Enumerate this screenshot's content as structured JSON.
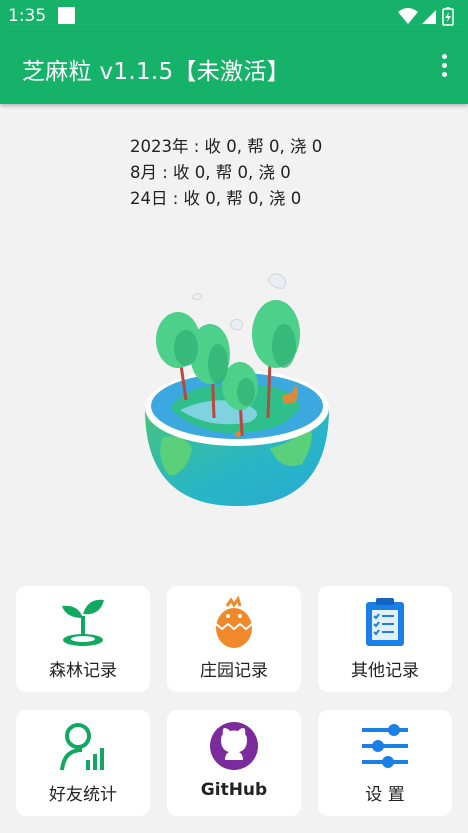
{
  "status_bar": {
    "time": "1:35"
  },
  "app_bar": {
    "title": "芝麻粒 v1.1.5【未激活】",
    "overflow_menu_icon": "more-vert-icon"
  },
  "stats": {
    "year_line": "2023年 : 收 0,  帮 0,  浇 0",
    "month_line": "8月 : 收 0,  帮 0,  浇 0",
    "day_line": "24日 : 收 0,  帮 0,  浇 0"
  },
  "illustration": {
    "icon": "forest-globe-illustration"
  },
  "menu": {
    "forest_records": {
      "label": "森林记录",
      "icon": "sprout-icon"
    },
    "farm_records": {
      "label": "庄园记录",
      "icon": "chick-egg-icon"
    },
    "other_records": {
      "label": "其他记录",
      "icon": "clipboard-checklist-icon"
    },
    "friend_stats": {
      "label": "好友统计",
      "icon": "user-stats-icon"
    },
    "github": {
      "label": "GitHub",
      "icon": "github-icon"
    },
    "settings": {
      "label": "设 置",
      "icon": "sliders-icon"
    }
  },
  "colors": {
    "primary": "#17b26a",
    "background": "#f2f2f2",
    "card": "#ffffff"
  }
}
